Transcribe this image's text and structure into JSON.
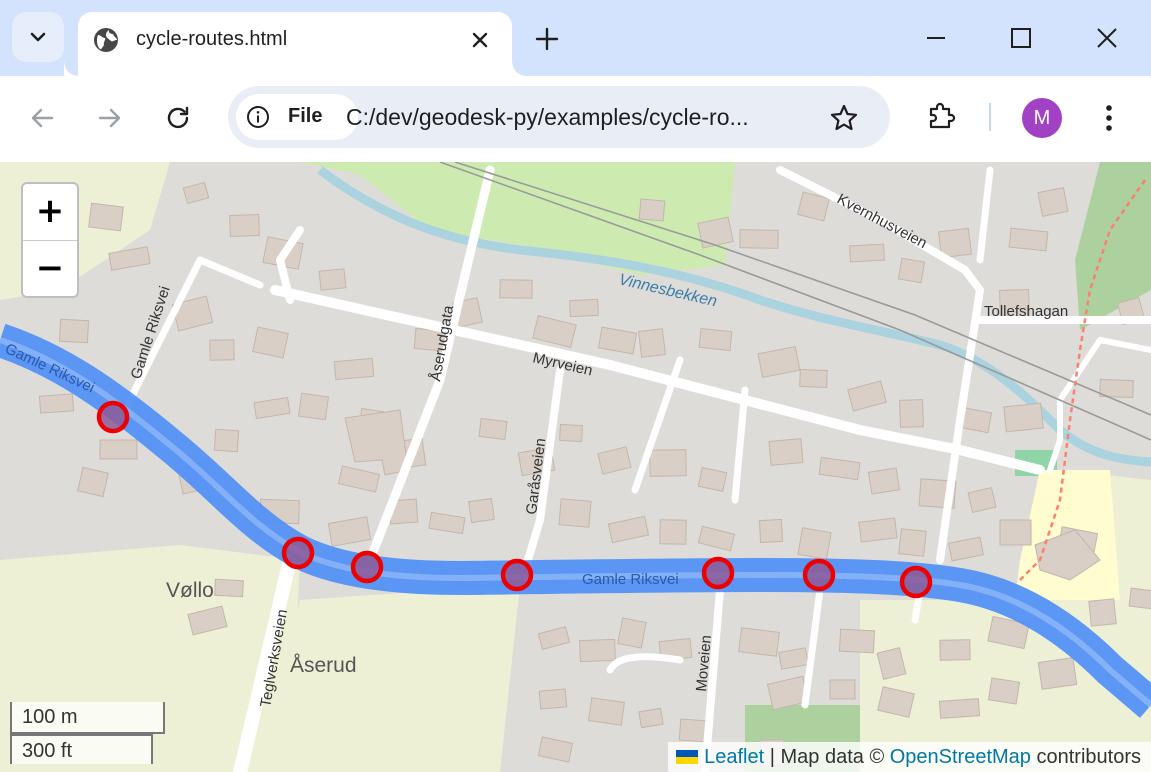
{
  "browser": {
    "tab": {
      "title": "cycle-routes.html"
    },
    "omnibox": {
      "chip_label": "File",
      "url": "C:/dev/geodesk-py/examples/cycle-ro..."
    },
    "profile_initial": "M"
  },
  "map": {
    "zoom": {
      "in_label": "+",
      "out_label": "−"
    },
    "scale": {
      "metric": "100 m",
      "imperial": "300 ft"
    },
    "attribution": {
      "leaflet": "Leaflet",
      "separator": " | Map data © ",
      "osm": "OpenStreetMap",
      "suffix": " contributors"
    },
    "labels": {
      "gamle_riksvei_nw": "Gamle Riksvei",
      "gamle_riksvei_mid": "Gamle Riksvei",
      "gamle_riksvei_road": "Gamle Riksvei",
      "aserudgata": "Åserudgata",
      "myrveien": "Myrveien",
      "garasveien": "Garåsveien",
      "teglverksveien": "Teglverksveien",
      "moveien": "Moveien",
      "kvernhusveien": "Kvernhusveien",
      "tollefshagan": "Tollefshagan",
      "vinnesbekken": "Vinnesbekken",
      "vollo": "Vøllo",
      "aserud": "Åserud"
    },
    "route_color": "#4f8ff7",
    "marker_color": "#ee0000",
    "marker_count": 7
  }
}
